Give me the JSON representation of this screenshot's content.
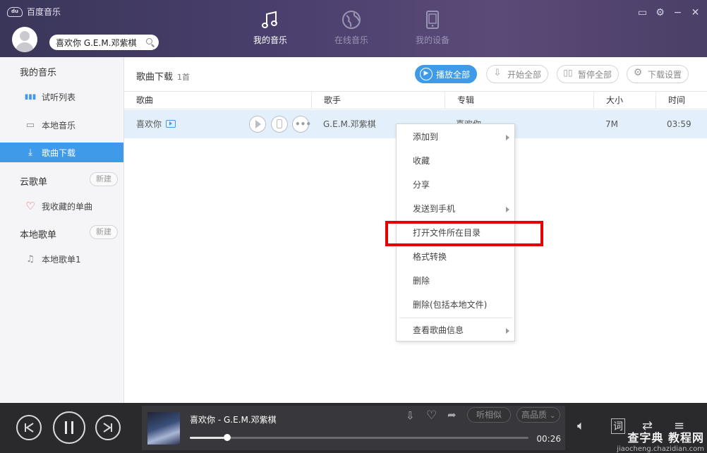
{
  "app": {
    "title": "百度音乐"
  },
  "search": {
    "value": "喜欢你 G.E.M.邓紫棋"
  },
  "nav": {
    "tabs": [
      {
        "label": "我的音乐",
        "active": true,
        "icon": "music-note-icon"
      },
      {
        "label": "在线音乐",
        "active": false,
        "icon": "globe-icon"
      },
      {
        "label": "我的设备",
        "active": false,
        "icon": "phone-icon"
      }
    ]
  },
  "sidebar": {
    "my_music_header": "我的音乐",
    "items": [
      {
        "label": "试听列表",
        "icon": "bars-icon"
      },
      {
        "label": "本地音乐",
        "icon": "monitor-icon"
      },
      {
        "label": "歌曲下载",
        "icon": "download-icon"
      }
    ],
    "cloud_header": "云歌单",
    "cloud_new": "新建",
    "favorites": "我收藏的单曲",
    "local_header": "本地歌单",
    "local_new": "新建",
    "local_list": "本地歌单1"
  },
  "main": {
    "title": "歌曲下载",
    "count": "1首",
    "buttons": {
      "play_all": "播放全部",
      "start_all": "开始全部",
      "pause_all": "暂停全部",
      "settings": "下载设置"
    },
    "columns": [
      "歌曲",
      "歌手",
      "专辑",
      "大小",
      "时间"
    ],
    "rows": [
      {
        "song": "喜欢你",
        "artist": "G.E.M.邓紫棋",
        "album": "喜欢你",
        "size": "7M",
        "time": "03:59"
      }
    ]
  },
  "context_menu": {
    "items": [
      {
        "label": "添加到",
        "submenu": true
      },
      {
        "label": "收藏",
        "submenu": false
      },
      {
        "label": "分享",
        "submenu": false
      },
      {
        "label": "发送到手机",
        "submenu": true
      },
      {
        "label": "打开文件所在目录",
        "submenu": false,
        "highlighted": true
      },
      {
        "label": "格式转换",
        "submenu": false
      },
      {
        "label": "删除",
        "submenu": false
      },
      {
        "label": "删除(包括本地文件)",
        "submenu": false
      },
      {
        "label": "查看歌曲信息",
        "submenu": true
      }
    ]
  },
  "player": {
    "now_playing": "喜欢你 - G.E.M.邓紫棋",
    "elapsed": "00:26",
    "progress": 0.11,
    "similar": "听相似",
    "quality": "高品质",
    "lyrics_label": "词"
  },
  "watermark": {
    "line1": "查字典 教程网",
    "line2": "jiaocheng.chazidian.com"
  },
  "colors": {
    "accent": "#3f9bea",
    "header": "#4a3f6d",
    "highlight_box": "#e60000",
    "player_bg": "#2a2a2d"
  }
}
